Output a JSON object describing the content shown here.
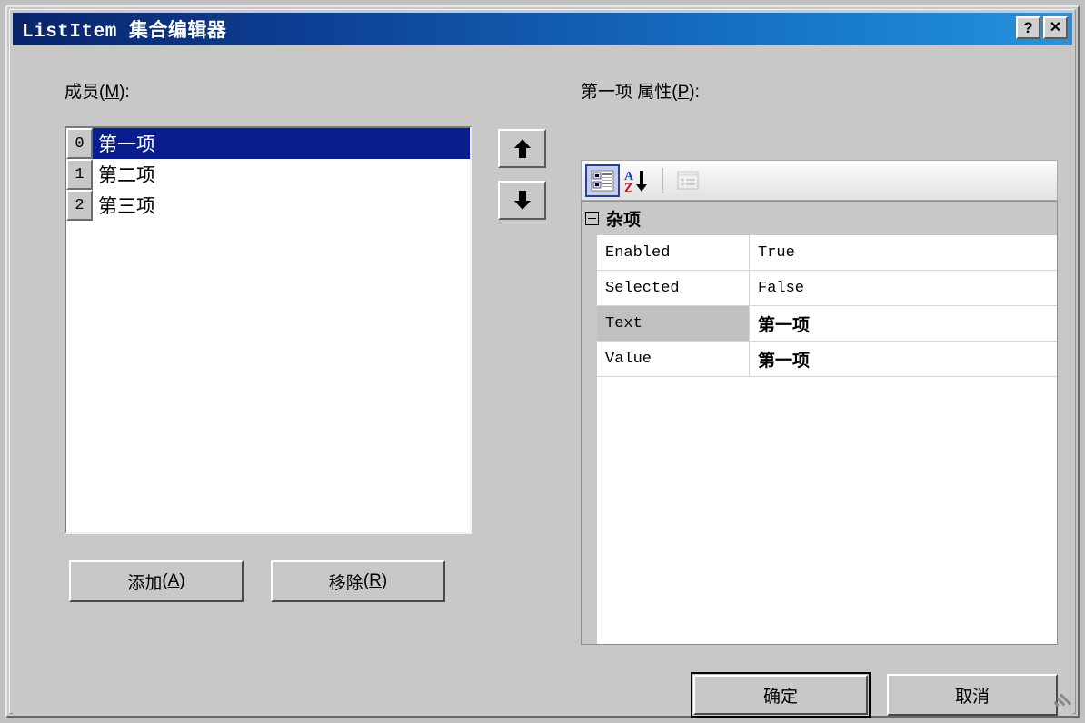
{
  "window": {
    "title": "ListItem 集合编辑器",
    "help_button": "?",
    "close_button": "✕",
    "help_icon_name": "help-icon",
    "close_icon_name": "close-icon"
  },
  "members_panel": {
    "label_text": "成员",
    "label_accel": "M",
    "label_suffix": "):",
    "label_prefix": "(",
    "items": [
      {
        "index": "0",
        "text": "第一项",
        "selected": true
      },
      {
        "index": "1",
        "text": "第二项",
        "selected": false
      },
      {
        "index": "2",
        "text": "第三项",
        "selected": false
      }
    ],
    "move_up_glyph": "⬆",
    "move_down_glyph": "⬇",
    "add_button": {
      "text": "添加",
      "accel": "A",
      "open": "(",
      "close": ")"
    },
    "remove_button": {
      "text": "移除",
      "accel": "R",
      "open": "(",
      "close": ")"
    }
  },
  "properties_panel": {
    "label_prefix": "第一项 属性",
    "label_open": "(",
    "label_accel": "P",
    "label_close": "):",
    "toolbar": {
      "categorized_icon": "categorized-view-icon",
      "alphabetical_icon": "alphabetical-sort-icon",
      "property_pages_icon": "property-pages-icon"
    },
    "category": "杂项",
    "rows": [
      {
        "name": "Enabled",
        "value": "True",
        "bold": false,
        "selected": false
      },
      {
        "name": "Selected",
        "value": "False",
        "bold": false,
        "selected": false
      },
      {
        "name": "Text",
        "value": "第一项",
        "bold": true,
        "selected": true
      },
      {
        "name": "Value",
        "value": "第一项",
        "bold": true,
        "selected": false
      }
    ]
  },
  "dialog_buttons": {
    "ok": "确定",
    "cancel": "取消"
  },
  "colors": {
    "title_gradient_start": "#0a246a",
    "title_gradient_end": "#2a92dd",
    "selection_blue": "#0a1d8c",
    "face": "#c8c8c8",
    "grid_gray": "#c0c0c0"
  }
}
